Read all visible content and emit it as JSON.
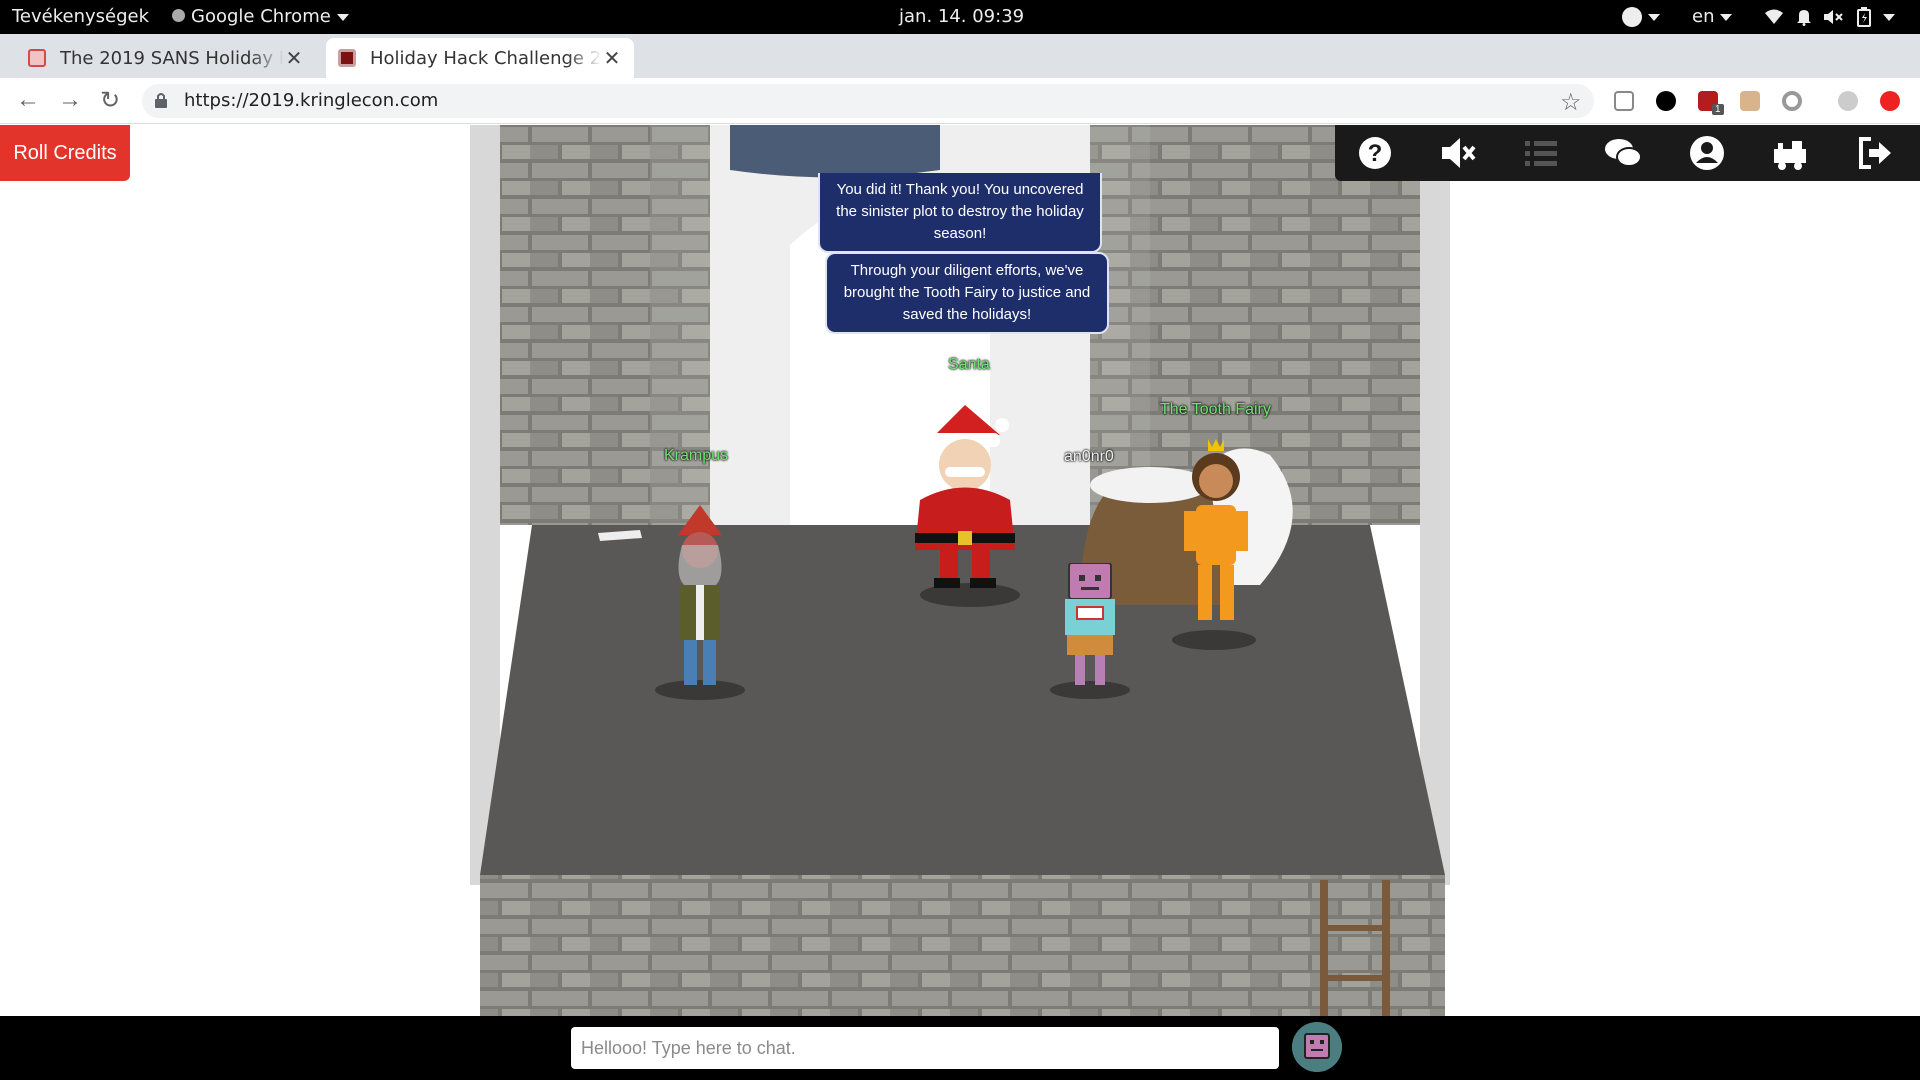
{
  "system_bar": {
    "activities": "Tevékenységek",
    "app_name": "Google Chrome",
    "datetime": "jan. 14.  09:39",
    "language": "en"
  },
  "tabs": [
    {
      "title": "The 2019 SANS Holiday Ha",
      "active": false
    },
    {
      "title": "Holiday Hack Challenge 20",
      "active": true
    }
  ],
  "toolbar": {
    "url": "https://2019.kringlecon.com",
    "extension_badge": "1"
  },
  "page": {
    "roll_credits_label": "Roll Credits",
    "game_menu_icons": [
      "help-icon",
      "mute-icon",
      "list-icon",
      "chat-icon",
      "user-icon",
      "train-icon",
      "logout-icon"
    ]
  },
  "scene": {
    "speech_bubbles": [
      "You did it! Thank you! You uncovered the sinister plot to destroy the holiday season!",
      "Through your diligent efforts, we've brought the Tooth Fairy to justice and saved the holidays!"
    ],
    "characters": {
      "santa": "Santa",
      "krampus": "Krampus",
      "player": "an0nr0",
      "tooth_fairy": "The Tooth Fairy"
    }
  },
  "chat": {
    "placeholder": "Hellooo! Type here to chat."
  },
  "colors": {
    "roll_credits_bg": "#e2342b",
    "bubble_bg": "#1e2e6b",
    "npc_name": "#6ee46e",
    "game_bar": "#1a1a1a"
  }
}
